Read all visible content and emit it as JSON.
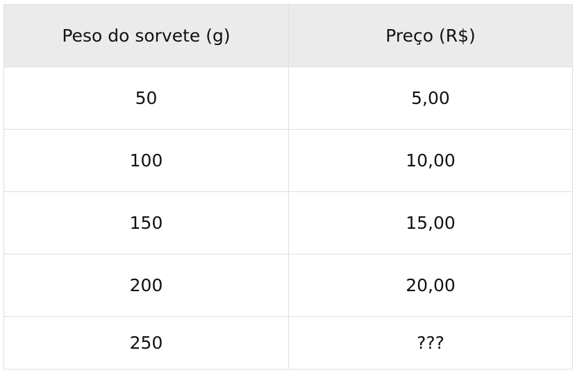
{
  "table": {
    "headers": [
      "Peso do sorvete (g)",
      "Preço (R$)"
    ],
    "rows": [
      [
        "50",
        "5,00"
      ],
      [
        "100",
        "10,00"
      ],
      [
        "150",
        "15,00"
      ],
      [
        "200",
        "20,00"
      ],
      [
        "250",
        "???"
      ]
    ]
  },
  "colors": {
    "header_background": "#ebebeb",
    "border": "#dedede",
    "text": "#111111"
  }
}
